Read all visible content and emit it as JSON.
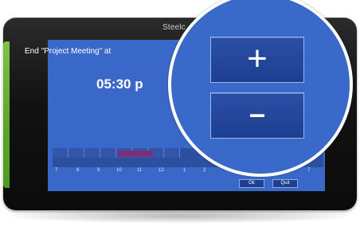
{
  "device": {
    "brand": "Steelc"
  },
  "dialog": {
    "event_text": "End \"Project Meeting\" at",
    "time_text": "05:30 p"
  },
  "timeline": {
    "hours": [
      "7",
      "8",
      "9",
      "10",
      "11",
      "12",
      "1",
      "2",
      "7"
    ],
    "booked_color": "#7a2f7a"
  },
  "buttons": {
    "ok": "Ok",
    "quit": "Quit",
    "plus": "+",
    "minus": "–"
  },
  "colors": {
    "screen_bg": "#3a68c8",
    "bezel": "#121212",
    "accent_strip": "#5aa528"
  }
}
